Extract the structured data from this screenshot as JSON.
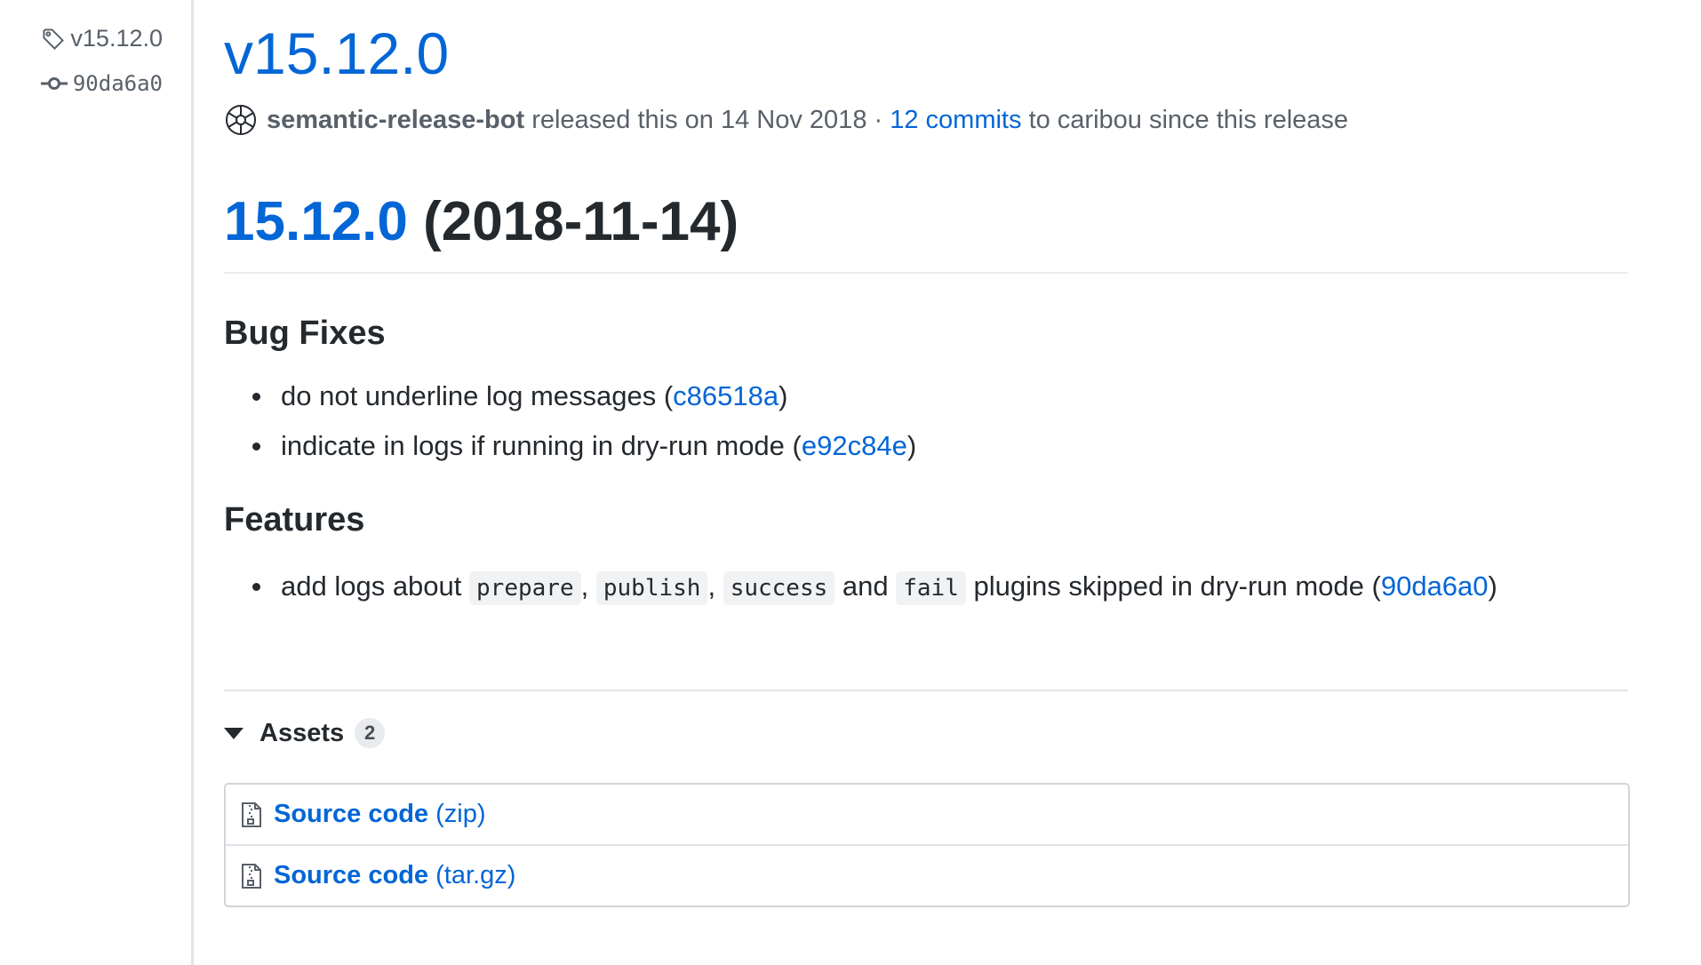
{
  "sidebar": {
    "tag_label": "v15.12.0",
    "commit_label": "90da6a0"
  },
  "release": {
    "title": "v15.12.0",
    "author": "semantic-release-bot",
    "released_text": "released this on 14 Nov 2018 ·",
    "commits_link": "12 commits",
    "since_text": "to caribou since this release"
  },
  "notes": {
    "version_link": "15.12.0",
    "version_date": "(2018-11-14)",
    "bugfix_heading": "Bug Fixes",
    "bugfixes": [
      {
        "text": "do not underline log messages (",
        "hash": "c86518a",
        "close": ")"
      },
      {
        "text": "indicate in logs if running in dry-run mode (",
        "hash": "e92c84e",
        "close": ")"
      }
    ],
    "features_heading": "Features",
    "feature": {
      "prefix": "add logs about",
      "code1": "prepare",
      "sep1": ",",
      "code2": "publish",
      "sep2": ",",
      "code3": "success",
      "and": "and",
      "code4": "fail",
      "suffix": "plugins skipped in dry-run mode (",
      "hash": "90da6a0",
      "close": ")"
    }
  },
  "assets": {
    "label": "Assets",
    "count": "2",
    "items": [
      {
        "name": "Source code",
        "ext": "(zip)",
        "icon": "file-zip-icon"
      },
      {
        "name": "Source code",
        "ext": "(tar.gz)",
        "icon": "file-zip-icon"
      }
    ]
  },
  "colors": {
    "link": "#0366d6",
    "text": "#24292e",
    "muted": "#586069"
  }
}
